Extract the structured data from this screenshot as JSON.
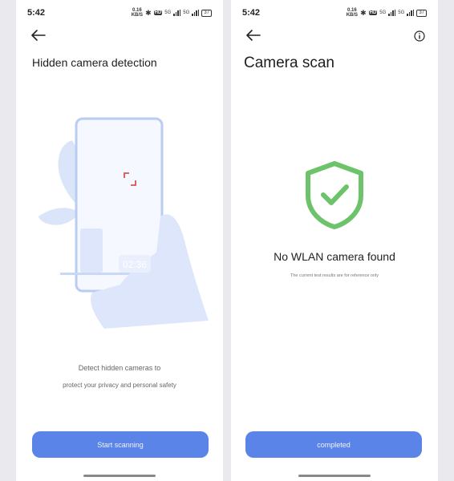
{
  "left_screen": {
    "status": {
      "time": "5:42",
      "net_speed": [
        "0.16",
        "KB/S"
      ],
      "hd": "HD",
      "signal1": "5G",
      "signal2": "5G",
      "battery": "37"
    },
    "title": "Hidden camera detection",
    "illustration_timestamp": "02:36",
    "description_line1": "Detect hidden cameras to",
    "description_line2": "protect your privacy and personal safety",
    "button_label": "Start scanning"
  },
  "right_screen": {
    "status": {
      "time": "5:42",
      "net_speed": [
        "0.16",
        "KB/S"
      ],
      "hd": "HD",
      "signal1": "5G",
      "signal2": "5G",
      "battery": "37"
    },
    "title": "Camera scan",
    "result": "No WLAN camera found",
    "note": "The current test results are for reference only",
    "button_label": "completed"
  },
  "colors": {
    "accent": "#5b84e8",
    "shield": "#6cc36a",
    "illustration": "#c9d8f6"
  },
  "icons": [
    "back-arrow-icon",
    "info-icon",
    "shield-check-icon",
    "bluetooth-icon",
    "signal-icon",
    "battery-icon"
  ]
}
